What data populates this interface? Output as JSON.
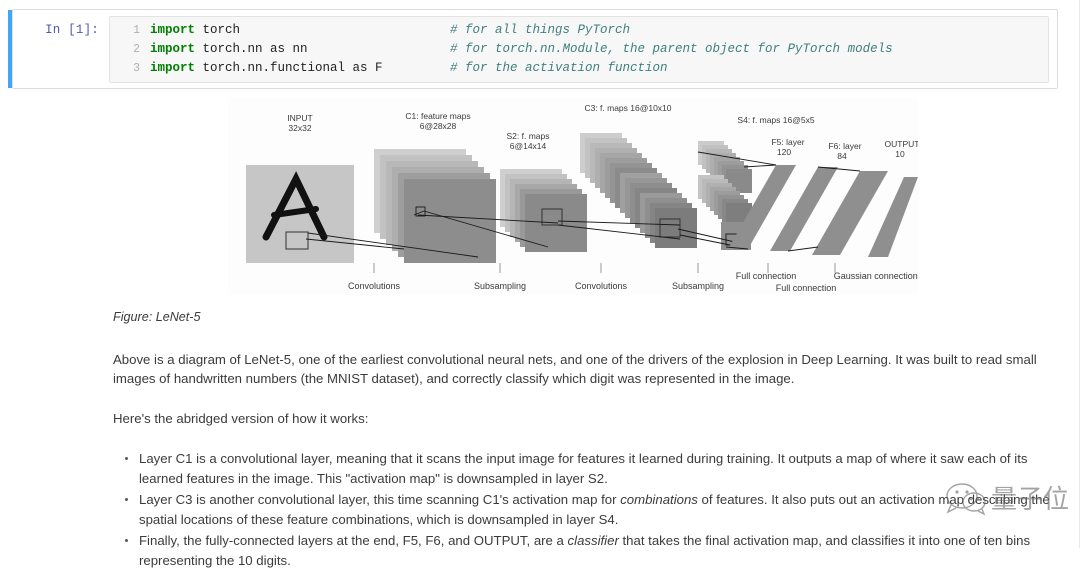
{
  "notebook": {
    "cell": {
      "prompt": "In [1]:",
      "lines": [
        {
          "num": "1",
          "kw": "import",
          "code": " torch",
          "comment": "# for all things PyTorch"
        },
        {
          "num": "2",
          "kw": "import",
          "code": " torch.nn as nn",
          "comment": "# for torch.nn.Module, the parent object for PyTorch models"
        },
        {
          "num": "3",
          "kw": "import",
          "code": " torch.nn.functional as F",
          "comment": "# for the activation function"
        }
      ]
    }
  },
  "figure": {
    "caption": "Figure: LeNet-5",
    "labels": {
      "input": "INPUT",
      "input_size": "32x32",
      "c1": "C1: feature maps",
      "c1_size": "6@28x28",
      "s2": "S2: f. maps",
      "s2_size": "6@14x14",
      "c3": "C3: f. maps 16@10x10",
      "s4": "S4: f. maps 16@5x5",
      "f5": "F5: layer",
      "f5_size": "120",
      "f6": "F6: layer",
      "f6_size": "84",
      "output": "OUTPUT",
      "output_size": "10",
      "conv1": "Convolutions",
      "sub1": "Subsampling",
      "conv2": "Convolutions",
      "sub2": "Subsampling",
      "full1": "Full connection",
      "full2": "Full connection",
      "gaussian": "Gaussian connections"
    }
  },
  "prose": {
    "intro": "Above is a diagram of LeNet-5, one of the earliest convolutional neural nets, and one of the drivers of the explosion in Deep Learning. It was built to read small images of handwritten numbers (the MNIST dataset), and correctly classify which digit was represented in the image.",
    "lead_in": "Here's the abridged version of how it works:",
    "bullets": [
      {
        "part1": "Layer C1 is a convolutional layer, meaning that it scans the input image for features it learned during training. It outputs a map of where it saw each of its learned features in the image. This \"activation map\" is downsampled in layer S2.",
        "italic": "",
        "part2": ""
      },
      {
        "part1": "Layer C3 is another convolutional layer, this time scanning C1's activation map for ",
        "italic": "combinations",
        "part2": " of features. It also puts out an activation map describing the spatial locations of these feature combinations, which is downsampled in layer S4."
      },
      {
        "part1": "Finally, the fully-connected layers at the end, F5, F6, and OUTPUT, are a ",
        "italic": "classifier",
        "part2": " that takes the final activation map, and classifies it into one of ten bins representing the 10 digits."
      }
    ]
  },
  "watermark": {
    "text": "量子位"
  },
  "colors": {
    "cell_accent": "#42a5f5",
    "keyword": "#008000",
    "comment": "#408080",
    "prompt": "#303f9f",
    "text": "#3b3b3b"
  }
}
